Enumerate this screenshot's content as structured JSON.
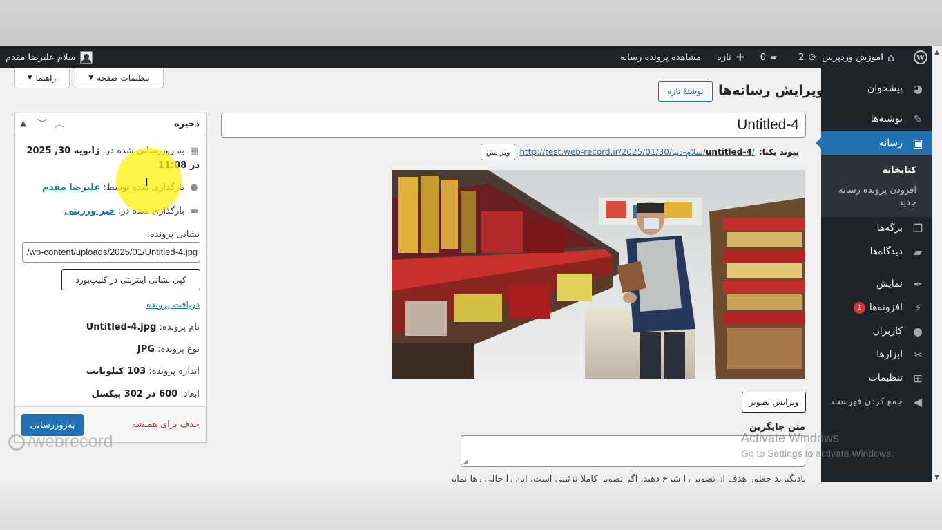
{
  "adminbar": {
    "site_name": "اموزش وردپرس",
    "updates_count": "2",
    "comments_count": "0",
    "new_label": "تازه",
    "view_label": "مشاهده پرونده رسانه",
    "greeting": "سلام علیرضا مقدم"
  },
  "sidebar": {
    "items": [
      {
        "label": "پیشخوان",
        "icon": "dashboard-icon"
      },
      {
        "label": "نوشته‌ها",
        "icon": "pin-icon"
      },
      {
        "label": "رسانه",
        "icon": "media-icon"
      },
      {
        "label": "برگه‌ها",
        "icon": "pages-icon"
      },
      {
        "label": "دیدگاه‌ها",
        "icon": "comments-icon"
      },
      {
        "label": "نمایش",
        "icon": "appearance-icon"
      },
      {
        "label": "افزونه‌ها",
        "icon": "plugins-icon",
        "badge": "1"
      },
      {
        "label": "کاربران",
        "icon": "users-icon"
      },
      {
        "label": "ابزارها",
        "icon": "tools-icon"
      },
      {
        "label": "تنظیمات",
        "icon": "settings-icon"
      },
      {
        "label": "جمع کردن فهرست",
        "icon": "collapse-icon"
      }
    ],
    "submenu": [
      "کتابخانه",
      "افزودن پرونده رسانه جدید"
    ]
  },
  "screen_options": {
    "settings_label": "تنظیمات صفحه",
    "help_label": "راهنما"
  },
  "main": {
    "page_title": "ویرایش رسانه‌ها",
    "add_new_label": "نوشتهٔ تازه",
    "title_value": "Untitled-4",
    "permalink_label": "پیوند یکتا:",
    "permalink_url": "http://test.web-record.ir/2025/01/30/سلام-دنیا/",
    "permalink_slug": "untitled-4",
    "permalink_edit_label": "ویرایش",
    "edit_image_label": "ویرایش تصویر",
    "alt_label": "متن جایگزین",
    "help_text": "یادبگیرید چطور هدف از تصویر را شرح دهید. اگر تصویر کاملا تزئینی است، این را خالی رها نمایید."
  },
  "save_box": {
    "title": "ذخیره",
    "updated_label": "به روزرسانی شده در:",
    "updated_value": "ژانویه 30, 2025 در 11:08",
    "uploaded_by_label": "بارگذاری شده توسط:",
    "uploaded_by_value": "علیرضا مقدم",
    "uploaded_to_label": "بارگذاری شده در:",
    "uploaded_to_value": "خیر ورزیتی",
    "file_url_label": "نشانی پرونده:",
    "file_url_value": "/wp-content/uploads/2025/01/Untitled-4.jpg",
    "copy_url_label": "کپی نشانی اینترنتی در کلیپ‌بورد",
    "download_label": "دریافت پرونده",
    "file_name_label": "نام پرونده:",
    "file_name_value": "Untitled-4.jpg",
    "file_type_label": "نوع پرونده:",
    "file_type_value": "JPG",
    "file_size_label": "اندازه پرونده:",
    "file_size_value": "103 کیلوبایت",
    "dimensions_label": "ابعاد:",
    "dimensions_value": "600 در 302 پیکسل",
    "delete_label": "حذف برای همیشه",
    "update_label": "به‌روزرسانی"
  },
  "overlay": {
    "watermark": "/webrecord",
    "activate_title": "Activate Windows",
    "activate_sub": "Go to Settings to activate Windows."
  },
  "colors": {
    "admin_dark": "#1d2327",
    "accent": "#2271b1",
    "badge": "#d63638",
    "highlight": "#fff000"
  }
}
